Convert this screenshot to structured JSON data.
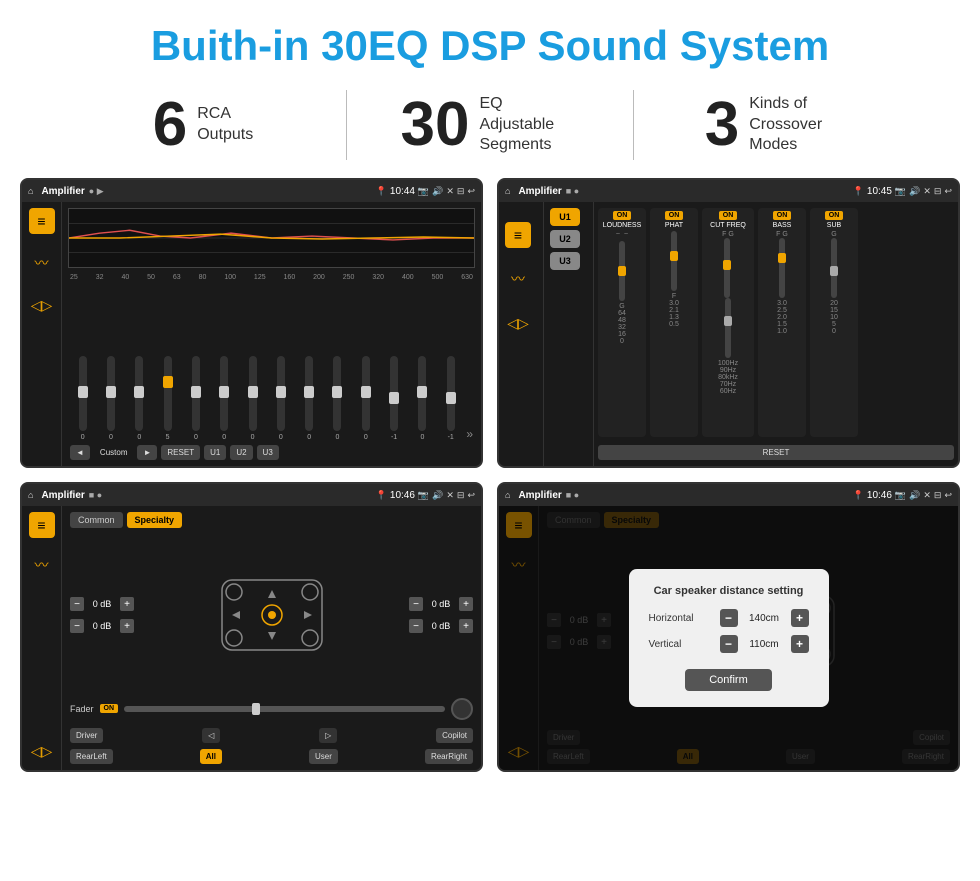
{
  "page": {
    "title": "Buith-in 30EQ DSP Sound System"
  },
  "stats": [
    {
      "number": "6",
      "desc_line1": "RCA",
      "desc_line2": "Outputs"
    },
    {
      "number": "30",
      "desc_line1": "EQ Adjustable",
      "desc_line2": "Segments"
    },
    {
      "number": "3",
      "desc_line1": "Kinds of",
      "desc_line2": "Crossover Modes"
    }
  ],
  "screens": [
    {
      "id": "screen1",
      "status": {
        "title": "Amplifier",
        "time": "10:44"
      },
      "eq_freqs": [
        "25",
        "32",
        "40",
        "50",
        "63",
        "80",
        "100",
        "125",
        "160",
        "200",
        "250",
        "320",
        "400",
        "500",
        "630"
      ],
      "eq_values": [
        "0",
        "0",
        "0",
        "5",
        "0",
        "0",
        "0",
        "0",
        "0",
        "0",
        "0",
        "-1",
        "0",
        "-1"
      ],
      "preset": "Custom",
      "buttons": [
        "RESET",
        "U1",
        "U2",
        "U3"
      ]
    },
    {
      "id": "screen2",
      "status": {
        "title": "Amplifier",
        "time": "10:45"
      },
      "u_buttons": [
        "U1",
        "U2",
        "U3"
      ],
      "modules": [
        {
          "name": "LOUDNESS",
          "on": true
        },
        {
          "name": "PHAT",
          "on": true
        },
        {
          "name": "CUT FREQ",
          "on": true
        },
        {
          "name": "BASS",
          "on": true
        },
        {
          "name": "SUB",
          "on": true
        }
      ]
    },
    {
      "id": "screen3",
      "status": {
        "title": "Amplifier",
        "time": "10:46"
      },
      "tabs": [
        "Common",
        "Specialty"
      ],
      "active_tab": "Specialty",
      "fader_label": "Fader",
      "fader_on": "ON",
      "db_values": [
        "0 dB",
        "0 dB",
        "0 dB",
        "0 dB"
      ],
      "buttons": [
        "Driver",
        "Copilot",
        "RearLeft",
        "All",
        "User",
        "RearRight"
      ]
    },
    {
      "id": "screen4",
      "status": {
        "title": "Amplifier",
        "time": "10:46"
      },
      "tabs": [
        "Common",
        "Specialty"
      ],
      "dialog": {
        "title": "Car speaker distance setting",
        "rows": [
          {
            "label": "Horizontal",
            "value": "140cm"
          },
          {
            "label": "Vertical",
            "value": "110cm"
          }
        ],
        "confirm_label": "Confirm"
      },
      "db_values": [
        "0 dB",
        "0 dB"
      ],
      "buttons": [
        "Driver",
        "Copilot",
        "RearLeft",
        "All",
        "User",
        "RearRight"
      ]
    }
  ]
}
